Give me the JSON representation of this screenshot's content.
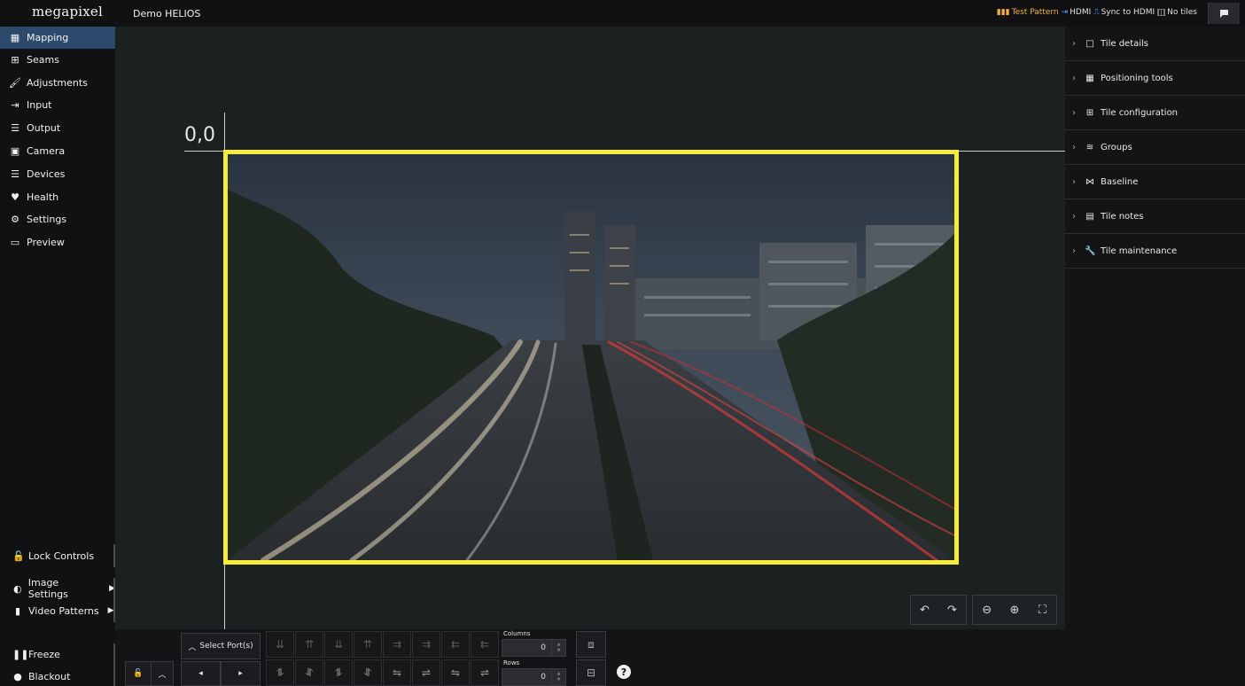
{
  "app": {
    "logo": "megapixel",
    "project": "Demo HELIOS"
  },
  "status": {
    "test_pattern": "Test Pattern",
    "hdmi": "HDMI",
    "sync": "Sync to HDMI",
    "tiles": "No tiles",
    "colors": {
      "test_pattern": "#f5b03c",
      "hdmi": "#4ea1ff"
    }
  },
  "sidebar": {
    "items": [
      {
        "label": "Mapping",
        "icon": "grid-table-icon",
        "active": true
      },
      {
        "label": "Seams",
        "icon": "plus-square-icon"
      },
      {
        "label": "Adjustments",
        "icon": "brush-icon"
      },
      {
        "label": "Input",
        "icon": "sign-in-icon"
      },
      {
        "label": "Output",
        "icon": "sliders-icon"
      },
      {
        "label": "Camera",
        "icon": "film-icon"
      },
      {
        "label": "Devices",
        "icon": "list-icon"
      },
      {
        "label": "Health",
        "icon": "heart-pulse-icon"
      },
      {
        "label": "Settings",
        "icon": "gears-icon"
      },
      {
        "label": "Preview",
        "icon": "monitor-icon"
      }
    ],
    "lock_controls": "Lock Controls",
    "image_settings": "Image Settings",
    "video_patterns": "Video Patterns",
    "freeze": "Freeze",
    "blackout": "Blackout"
  },
  "canvas": {
    "origin_label": "0,0",
    "tile_border_color": "#f6ea3a"
  },
  "right_panel": {
    "sections": [
      {
        "label": "Tile details",
        "icon": "square-icon"
      },
      {
        "label": "Positioning tools",
        "icon": "grid-table-icon"
      },
      {
        "label": "Tile configuration",
        "icon": "plus-square-icon"
      },
      {
        "label": "Groups",
        "icon": "layers-icon"
      },
      {
        "label": "Baseline",
        "icon": "network-icon"
      },
      {
        "label": "Tile notes",
        "icon": "file-icon"
      },
      {
        "label": "Tile maintenance",
        "icon": "wrench-icon"
      }
    ]
  },
  "bottom": {
    "select_ports": "Select Port(s)",
    "columns_label": "Columns",
    "columns_value": "0",
    "rows_label": "Rows",
    "rows_value": "0",
    "help": "?"
  }
}
